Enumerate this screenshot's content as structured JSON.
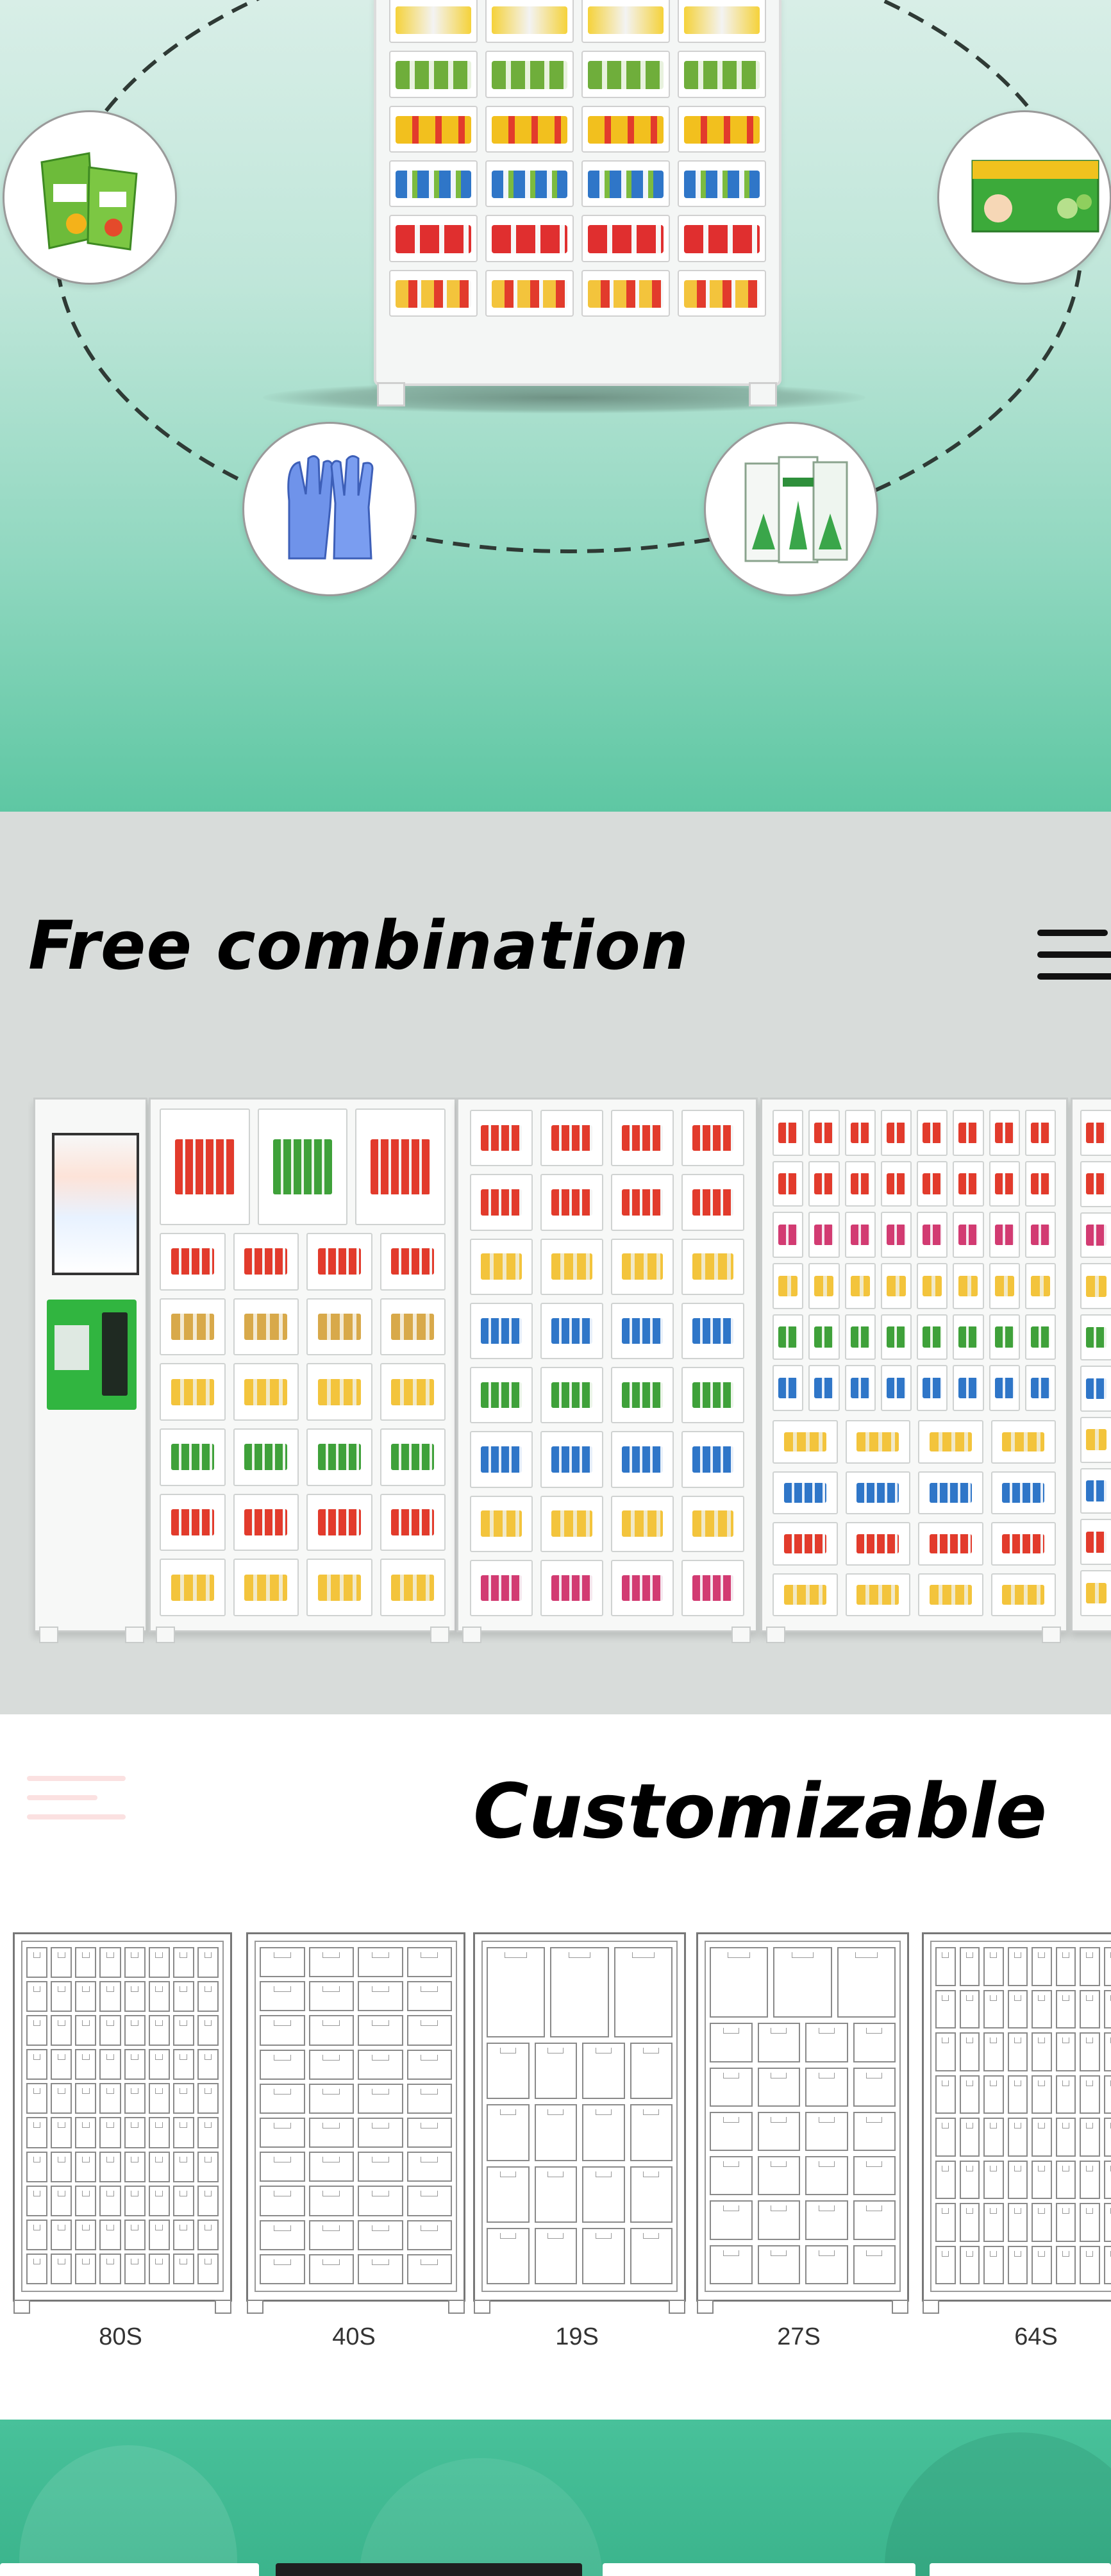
{
  "section_free": {
    "title": "Free combination"
  },
  "section_custom": {
    "title": "Customizable",
    "models": [
      {
        "label": "80S"
      },
      {
        "label": "40S"
      },
      {
        "label": "19S"
      },
      {
        "label": "27S"
      },
      {
        "label": "64S"
      }
    ]
  },
  "colors": {
    "mint_top": "#d8eee7",
    "mint_bottom": "#5ec7a3",
    "gray_band": "#d8dcda",
    "banner_green": "#48c19a"
  },
  "icons": {
    "orbit_items": [
      "chips-bag-icon",
      "medicine-box-icon",
      "gloves-icon",
      "health-packs-icon"
    ],
    "menu": "hamburger-menu-icon"
  }
}
